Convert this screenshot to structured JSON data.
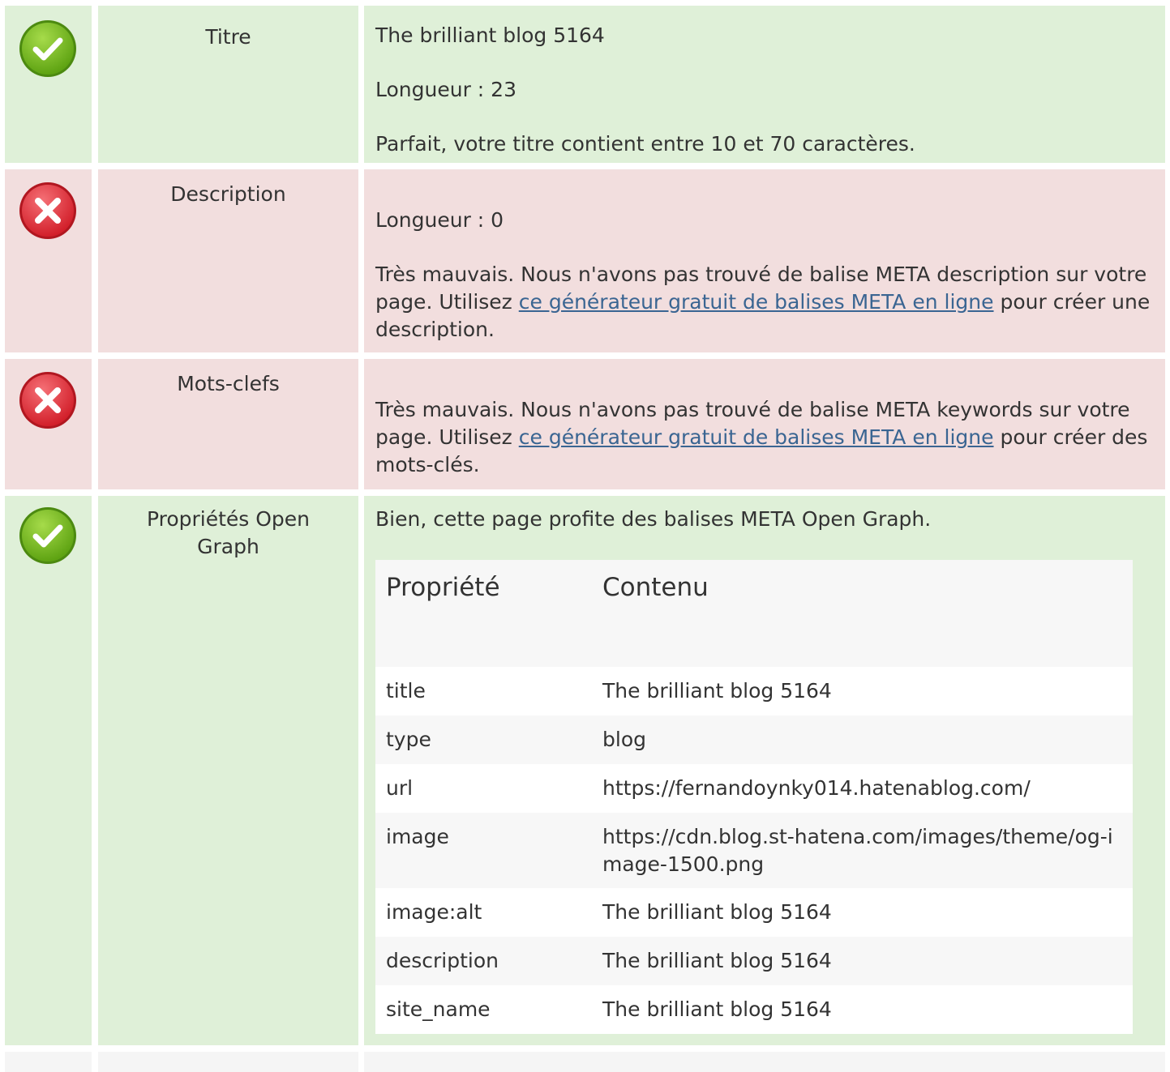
{
  "rows": [
    {
      "status": "success",
      "icon": "check-circle-icon",
      "label": "Titre",
      "lines": [
        "The brilliant blog 5164",
        "Longueur : 23",
        "Parfait, votre titre contient entre 10 et 70 caractères."
      ]
    },
    {
      "status": "error",
      "icon": "cross-circle-icon",
      "label": "Description",
      "length_text": "Longueur : 0",
      "message_before": "Très mauvais. Nous n'avons pas trouvé de balise META description sur votre page. Utilisez ",
      "link_text": "ce générateur gratuit de balises META en ligne",
      "message_after": " pour créer une description."
    },
    {
      "status": "error",
      "icon": "cross-circle-icon",
      "label": "Mots-clefs",
      "message_before": "Très mauvais. Nous n'avons pas trouvé de balise META keywords sur votre page. Utilisez ",
      "link_text": "ce générateur gratuit de balises META en ligne",
      "message_after": " pour créer des mots-clés."
    },
    {
      "status": "success",
      "icon": "check-circle-icon",
      "label": "Propriétés Open Graph",
      "message": "Bien, cette page profite des balises META Open Graph.",
      "table_headers": [
        "Propriété",
        "Contenu"
      ],
      "table_rows": [
        {
          "property": "title",
          "content": "The brilliant blog 5164"
        },
        {
          "property": "type",
          "content": "blog"
        },
        {
          "property": "url",
          "content": "https://fernandoynky014.hatenablog.com/"
        },
        {
          "property": "image",
          "content": "https://cdn.blog.st-hatena.com/images/theme/og-image-1500.png"
        },
        {
          "property": "image:alt",
          "content": "The brilliant blog 5164"
        },
        {
          "property": "description",
          "content": "The brilliant blog 5164"
        },
        {
          "property": "site_name",
          "content": "The brilliant blog 5164"
        }
      ]
    }
  ],
  "colors": {
    "success_bg": "#dff0d8",
    "error_bg": "#f2dede",
    "link": "#3a6592",
    "success_icon": "#7cc022",
    "error_icon": "#e5343d"
  }
}
